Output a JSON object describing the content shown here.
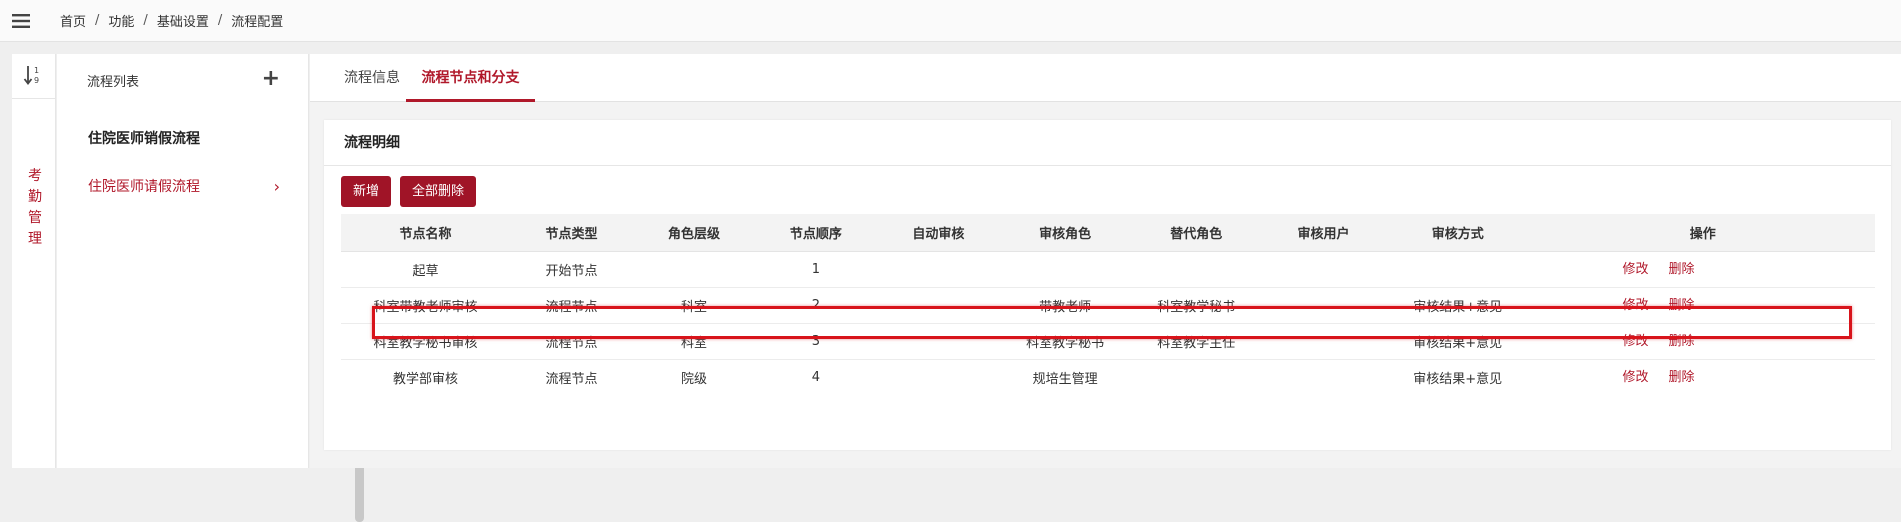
{
  "breadcrumb": [
    "首页",
    "功能",
    "基础设置",
    "流程配置"
  ],
  "breadcrumb_sep": "/",
  "strip": {
    "vertical_label": [
      "考",
      "勤",
      "管",
      "理"
    ]
  },
  "flow_list": {
    "title": "流程列表",
    "add_symbol": "+",
    "items": [
      {
        "label": "住院医师销假流程"
      },
      {
        "label": "住院医师请假流程",
        "chevron": "›"
      }
    ]
  },
  "tabs": [
    "流程信息",
    "流程节点和分支"
  ],
  "detail": {
    "title": "流程明细",
    "buttons": {
      "add": "新增",
      "delete_all": "全部删除"
    },
    "columns": [
      "节点名称",
      "节点类型",
      "角色层级",
      "节点顺序",
      "自动审核",
      "审核角色",
      "替代角色",
      "审核用户",
      "审核方式",
      "操作"
    ],
    "rows": [
      {
        "name": "起草",
        "type": "开始节点",
        "level": "",
        "order": "1",
        "auto": "",
        "role": "",
        "alt_role": "",
        "user": "",
        "method": ""
      },
      {
        "name": "科室带教老师审核",
        "type": "流程节点",
        "level": "科室",
        "order": "2",
        "auto": "",
        "role": "带教老师",
        "alt_role": "科室教学秘书",
        "user": "",
        "method": "审核结果+意见"
      },
      {
        "name": "科室教学秘书审核",
        "type": "流程节点",
        "level": "科室",
        "order": "3",
        "auto": "",
        "role": "科室教学秘书",
        "alt_role": "科室教学主任",
        "user": "",
        "method": "审核结果+意见"
      },
      {
        "name": "教学部审核",
        "type": "流程节点",
        "level": "院级",
        "order": "4",
        "auto": "",
        "role": "规培生管理",
        "alt_role": "",
        "user": "",
        "method": "审核结果+意见"
      }
    ],
    "actions": {
      "edit": "修改",
      "delete": "删除"
    }
  },
  "colors": {
    "accent": "#b0182a",
    "button": "#a01427",
    "highlight": "#d8141b"
  }
}
